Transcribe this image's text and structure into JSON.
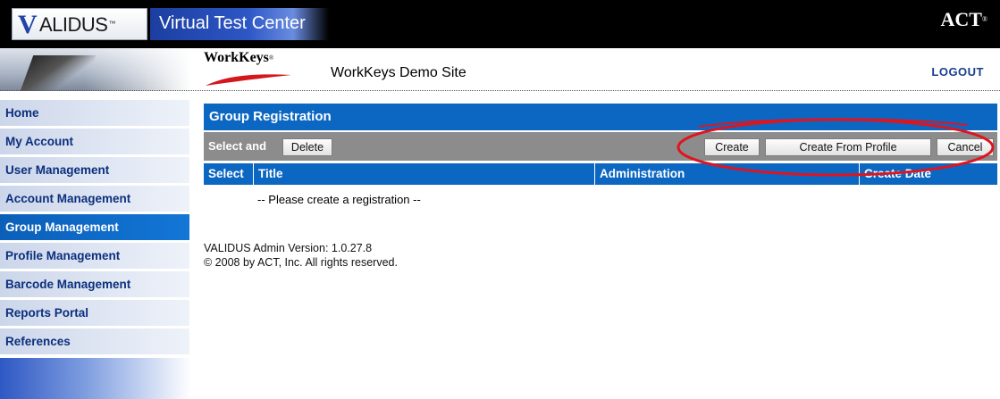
{
  "header": {
    "brand_v": "V",
    "brand_rest": "ALIDUS",
    "brand_tm": "™",
    "product_title": "Virtual Test Center",
    "act_logo": "ACT",
    "act_reg": "®",
    "workkeys_logo": "WorkKeys",
    "workkeys_reg": "®",
    "site_name": "WorkKeys Demo Site",
    "logout_label": "LOGOUT"
  },
  "sidebar": {
    "items": [
      {
        "label": "Home",
        "active": false
      },
      {
        "label": "My Account",
        "active": false
      },
      {
        "label": "User Management",
        "active": false
      },
      {
        "label": "Account Management",
        "active": false
      },
      {
        "label": "Group Management",
        "active": true
      },
      {
        "label": "Profile Management",
        "active": false
      },
      {
        "label": "Barcode Management",
        "active": false
      },
      {
        "label": "Reports Portal",
        "active": false
      },
      {
        "label": "References",
        "active": false
      }
    ]
  },
  "main": {
    "title": "Group Registration",
    "action_bar": {
      "select_and_label": "Select and",
      "delete_label": "Delete",
      "create_label": "Create",
      "create_from_profile_label": "Create From Profile",
      "cancel_label": "Cancel"
    },
    "table": {
      "columns": [
        "Select",
        "Title",
        "Administration",
        "Create Date"
      ],
      "empty_message": "-- Please create a registration --"
    }
  },
  "footer": {
    "version": "VALIDUS Admin Version: 1.0.27.8",
    "copyright": "© 2008 by ACT, Inc. All rights reserved."
  },
  "colors": {
    "primary_blue": "#0b67c2",
    "action_bar_gray": "#8c8c8c",
    "nav_text": "#0c2f7d",
    "highlight_red": "#e0141e"
  }
}
